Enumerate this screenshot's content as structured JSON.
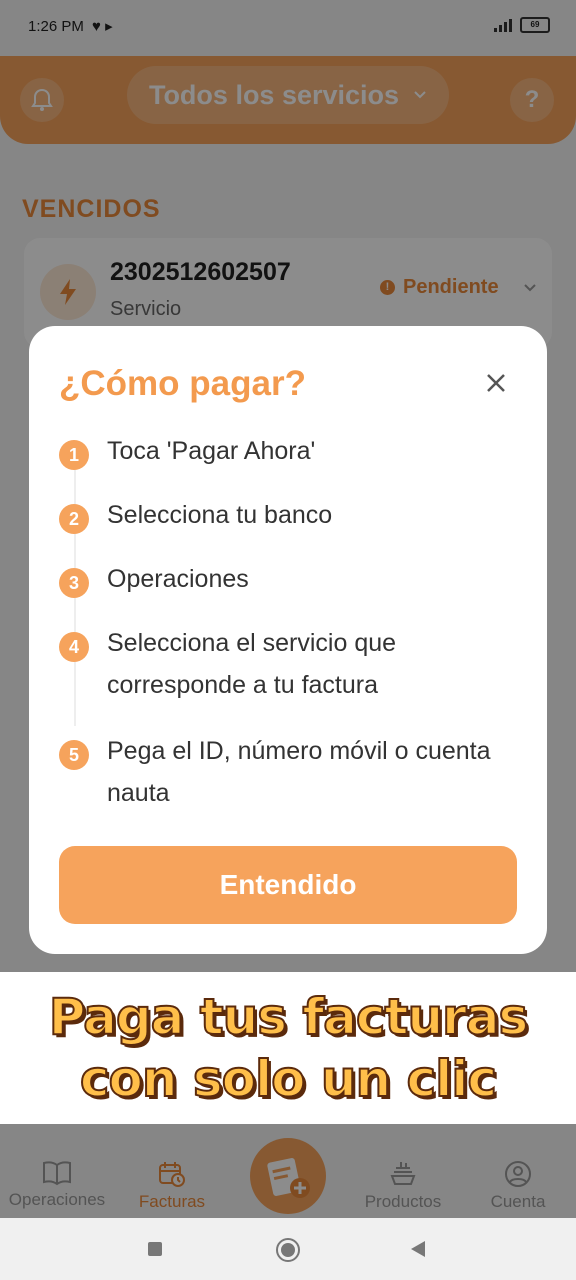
{
  "status_bar": {
    "time": "1:26 PM",
    "battery": "69"
  },
  "header": {
    "selector_label": "Todos los servicios",
    "help_label": "?"
  },
  "section": {
    "title": "VENCIDOS"
  },
  "bill": {
    "number": "2302512602507",
    "type": "Servicio",
    "status": "Pendiente",
    "status_icon": "!"
  },
  "modal": {
    "title": "¿Cómo pagar?",
    "steps": [
      {
        "n": "1",
        "text": "Toca 'Pagar Ahora'"
      },
      {
        "n": "2",
        "text": "Selecciona tu banco"
      },
      {
        "n": "3",
        "text": "Operaciones"
      },
      {
        "n": "4",
        "text": "Selecciona el servicio que corresponde a tu factura"
      },
      {
        "n": "5",
        "text": "Pega el ID, número móvil o cuenta nauta"
      }
    ],
    "button_label": "Entendido"
  },
  "promo": {
    "line1": "Paga tus facturas",
    "line2": "con solo un clic"
  },
  "bottom_nav": {
    "items": [
      {
        "label": "Operaciones",
        "icon": "book-icon"
      },
      {
        "label": "Facturas",
        "icon": "calendar-clock-icon"
      },
      {
        "label": "Productos",
        "icon": "food-icon"
      },
      {
        "label": "Cuenta",
        "icon": "user-icon"
      }
    ]
  },
  "colors": {
    "accent": "#f6a35c",
    "accent_dark": "#e9893b",
    "promo_fill": "#ffbf4a",
    "promo_stroke": "#5b2a0c"
  }
}
